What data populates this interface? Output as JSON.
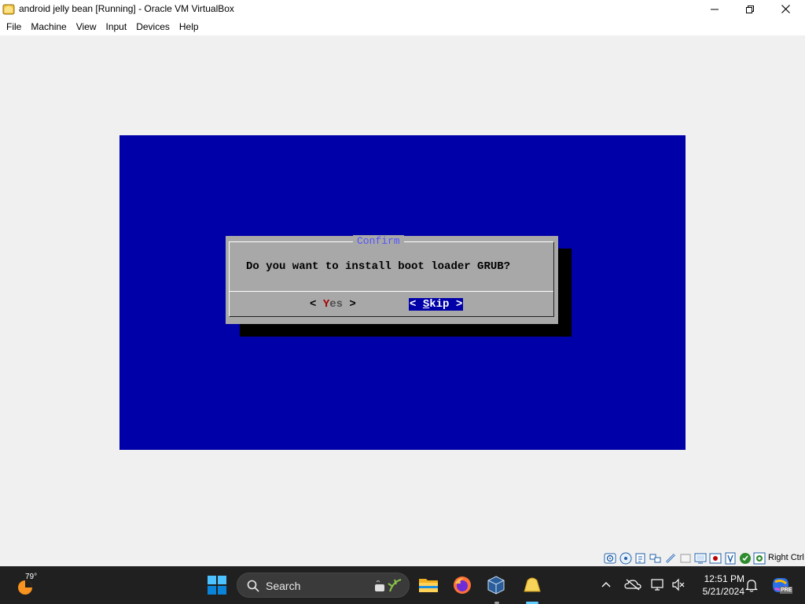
{
  "window": {
    "title": "android jelly bean [Running] - Oracle VM VirtualBox"
  },
  "menu": {
    "items": [
      "File",
      "Machine",
      "View",
      "Input",
      "Devices",
      "Help"
    ]
  },
  "dialog": {
    "title": "Confirm",
    "question": "Do you want to install boot loader GRUB?",
    "yes": {
      "open": "< ",
      "hotkey": "Y",
      "rest": "es",
      "close": " >"
    },
    "skip": {
      "open": "< ",
      "hotkey": "S",
      "rest": "kip",
      "close": " >"
    },
    "focused_button": "Skip",
    "colors": {
      "screen_bg": "#0000a8",
      "dialog_bg": "#a8a8a8",
      "title_fg": "#5454fc",
      "hotkey_fg": "#a80000"
    }
  },
  "statusbar": {
    "host_key": "Right Ctrl",
    "indicators": [
      "hard-disk-icon",
      "optical-disk-icon",
      "audio-icon",
      "network-icon",
      "usb-icon",
      "shared-folders-icon",
      "display-icon",
      "recording-icon",
      "cpu-icon",
      "mouse-integration-icon",
      "keyboard-icon"
    ]
  },
  "taskbar": {
    "temperature": "79°",
    "search_placeholder": "Search",
    "apps": [
      "windows-start-icon",
      "search-icon",
      "file-explorer-icon",
      "firefox-icon",
      "virtualbox-icon",
      "virtualbox-vm-icon"
    ],
    "clock": {
      "time": "12:51 PM",
      "date": "5/21/2024"
    },
    "copilot_badge": "PRE"
  }
}
